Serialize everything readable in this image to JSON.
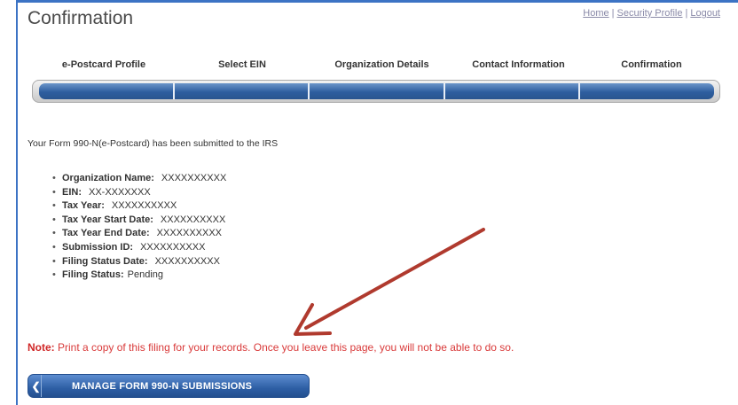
{
  "page": {
    "title": "Confirmation"
  },
  "top_links": {
    "home": "Home",
    "separator": "|",
    "security_profile": "Security Profile",
    "logout": "Logout"
  },
  "steps": [
    "e-Postcard Profile",
    "Select EIN",
    "Organization Details",
    "Contact Information",
    "Confirmation"
  ],
  "intro_text": "Your Form 990-N(e-Postcard) has been submitted to the IRS",
  "details": [
    {
      "label": "Organization Name:",
      "value": "XXXXXXXXXX"
    },
    {
      "label": "EIN:",
      "value": "XX-XXXXXXX"
    },
    {
      "label": "Tax Year:",
      "value": "XXXXXXXXXX"
    },
    {
      "label": "Tax Year Start Date:",
      "value": "XXXXXXXXXX"
    },
    {
      "label": "Tax Year End Date:",
      "value": "XXXXXXXXXX"
    },
    {
      "label": "Submission ID:",
      "value": "XXXXXXXXXX"
    },
    {
      "label": "Filing Status Date:",
      "value": "XXXXXXXXXX"
    },
    {
      "label": "Filing Status:",
      "value": "Pending"
    }
  ],
  "note": {
    "label": "Note:",
    "text": "Print a copy of this filing for your records. Once you leave this page, you will not be able to do so."
  },
  "button": {
    "icon": "chevron-left-icon",
    "label": "MANAGE FORM 990-N SUBMISSIONS"
  },
  "colors": {
    "accent_blue": "#2e5fa5",
    "note_red": "#d93a3a",
    "arrow_red": "#b03a2e"
  }
}
